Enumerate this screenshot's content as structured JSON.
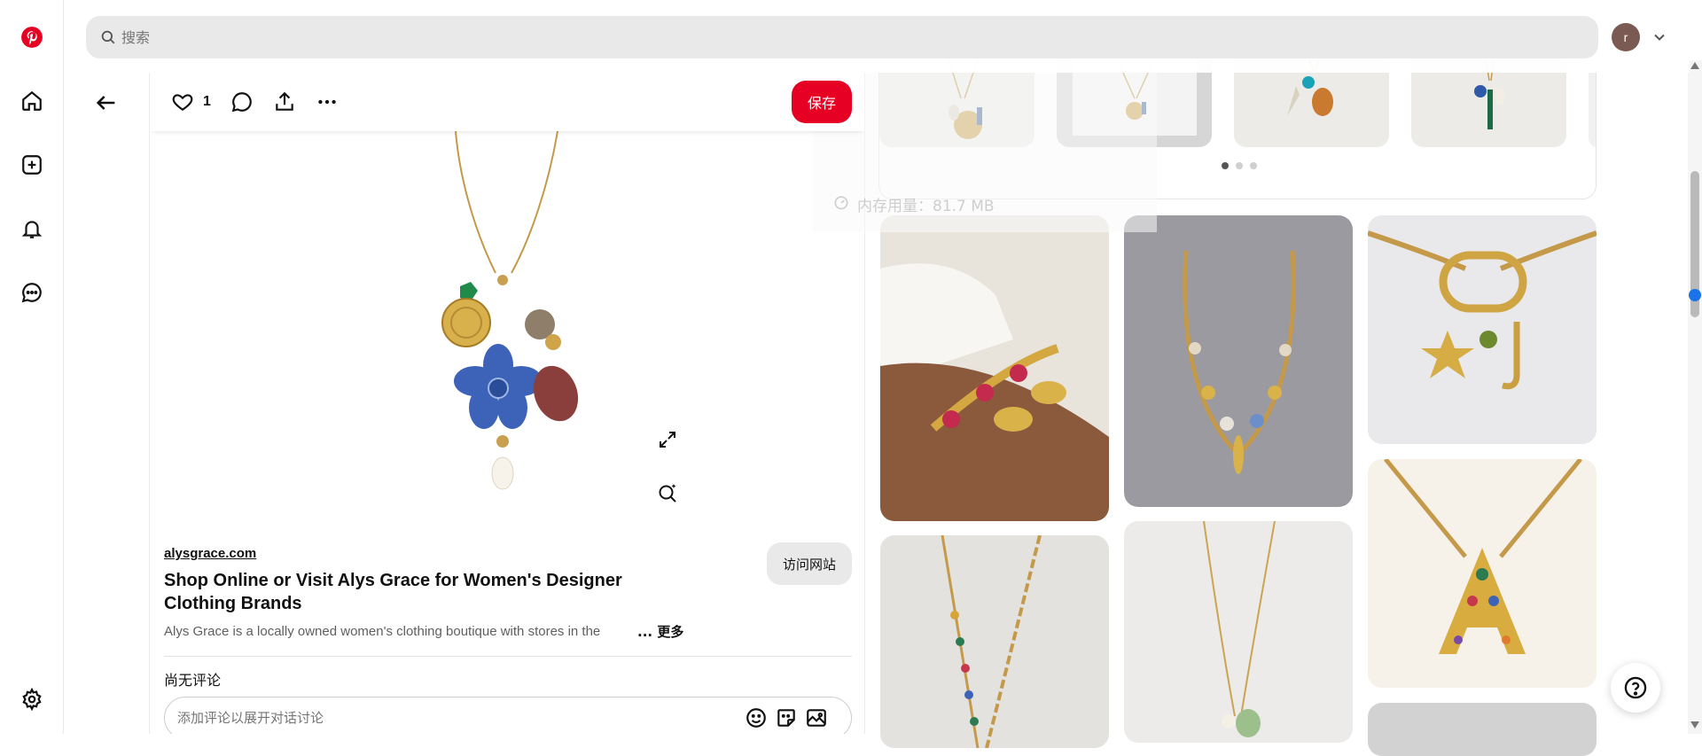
{
  "search": {
    "placeholder": "搜索"
  },
  "user": {
    "avatar_letter": "r"
  },
  "pin": {
    "like_count": "1",
    "save_label": "保存",
    "domain": "alysgrace.com",
    "visit_label": "访问网站",
    "title": "Shop Online or Visit Alys Grace for Women's Designer Clothing Brands",
    "description": "Alys Grace is a locally owned women's clothing boutique with stores in the",
    "more_label": "... 更多",
    "comments_status": "尚无评论",
    "comment_placeholder": "添加评论以展开对话讨论"
  },
  "overlay": {
    "memory_text": "内存用量：81.7 MB"
  },
  "colors": {
    "brand": "#e60023",
    "search_bg": "#e9e9e9"
  }
}
